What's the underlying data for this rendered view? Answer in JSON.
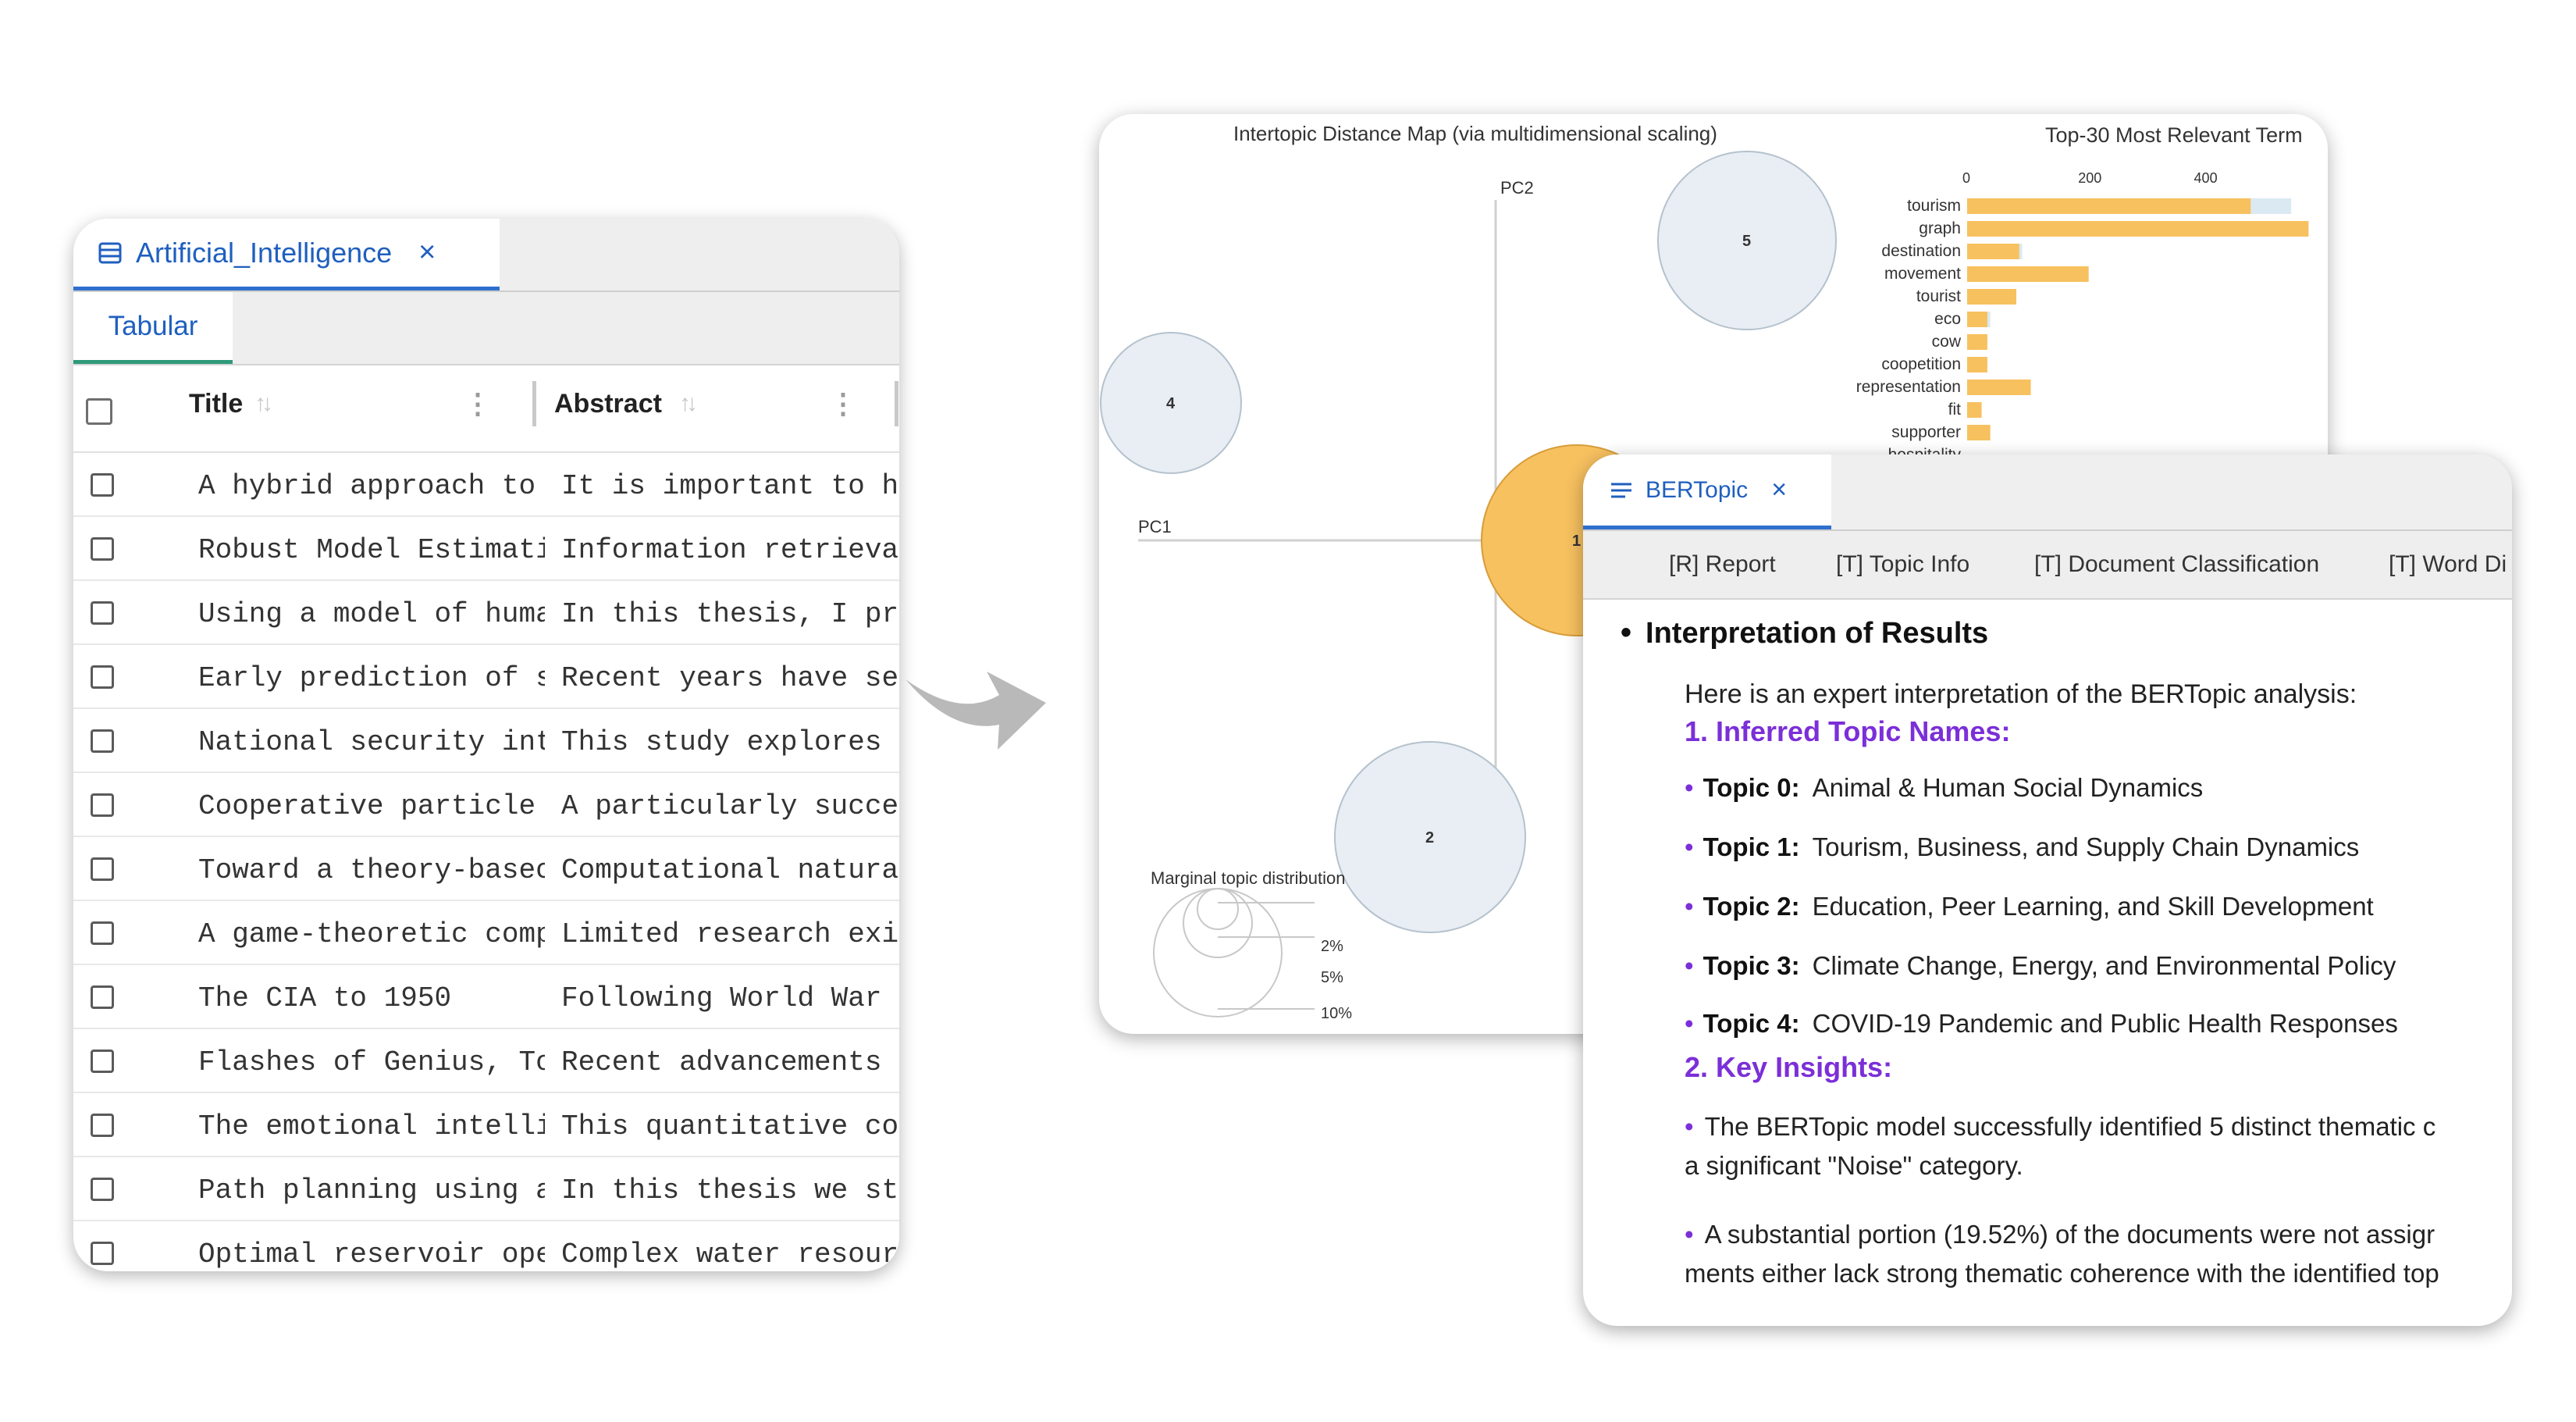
{
  "dataset_panel": {
    "tab_title": "Artificial_Intelligence",
    "tab_close": "×",
    "subtab": "Tabular",
    "columns": {
      "title": "Title",
      "abstract": "Abstract"
    },
    "sort_glyph": "↑↓",
    "menu_glyph": "⋮",
    "rows": [
      {
        "title": "A hybrid approach to",
        "abstract": "It is important to ha"
      },
      {
        "title": "Robust Model Estimati",
        "abstract": "Information retrieval"
      },
      {
        "title": "Using a model of huma",
        "abstract": "In this thesis, I pre"
      },
      {
        "title": "Early prediction of s",
        "abstract": "Recent years have see"
      },
      {
        "title": "National security int",
        "abstract": "This study explores m"
      },
      {
        "title": "Cooperative particle",
        "abstract": "A particularly succes"
      },
      {
        "title": "Toward a theory-basec",
        "abstract": "Computational natural"
      },
      {
        "title": "A game-theoretic comp",
        "abstract": "Limited research exis"
      },
      {
        "title": "The CIA to 1950",
        "abstract": "Following World War I"
      },
      {
        "title": "Flashes of Genius, To",
        "abstract": "Recent advancements i"
      },
      {
        "title": "The emotional intelli",
        "abstract": "This quantitative cor"
      },
      {
        "title": "Path planning using a",
        "abstract": "In this thesis we stu"
      },
      {
        "title": "Optimal reservoir ope",
        "abstract": "Complex water resourc"
      }
    ]
  },
  "visualization": {
    "distance_map_title": "Intertopic Distance Map (via multidimensional scaling)",
    "pc2_label": "PC2",
    "pc1_label": "PC1",
    "bubbles": [
      {
        "label": "5",
        "color": "#e8eef4"
      },
      {
        "label": "4",
        "color": "#e8eef4"
      },
      {
        "label": "2",
        "color": "#e8eef4"
      },
      {
        "label": "1",
        "color": "#f7c160"
      }
    ],
    "marginal_title": "Marginal topic distribution",
    "marginal_legend": [
      "2%",
      "5%",
      "10%"
    ],
    "terms_title": "Top-30 Most Relevant Term",
    "terms_axis_ticks": [
      "0",
      "200",
      "400"
    ],
    "terms": [
      "tourism",
      "graph",
      "destination",
      "movement",
      "tourist",
      "eco",
      "cow",
      "coopetition",
      "representation",
      "fit",
      "supporter",
      "hospitality"
    ],
    "bar_color": "#f7c160",
    "bar_bg_color": "#dbe9f2"
  },
  "chart_data": {
    "type": "bar",
    "title": "Top-30 Most Relevant Term",
    "categories": [
      "tourism",
      "graph",
      "destination",
      "movement",
      "tourist",
      "eco",
      "cow",
      "coopetition",
      "representation",
      "fit",
      "supporter"
    ],
    "series": [
      {
        "values": [
          490,
          590,
          90,
          210,
          85,
          35,
          35,
          35,
          110,
          25,
          40
        ]
      },
      {
        "values": [
          560,
          570,
          95,
          150,
          75,
          40,
          30,
          30,
          85,
          25,
          35
        ]
      }
    ],
    "xlim": [
      0,
      580
    ],
    "xticks": [
      0,
      200,
      400
    ]
  },
  "bertopic_panel": {
    "tab_title": "BERTopic",
    "tab_close": "×",
    "subtabs": [
      "[R] Report",
      "[T] Topic Info",
      "[T] Document Classification",
      "[T] Word Di"
    ],
    "heading": "Interpretation of Results",
    "intro": "Here is an expert interpretation of the BERTopic analysis:",
    "section1": "1. Inferred Topic Names:",
    "topics": [
      {
        "key": "Topic 0:",
        "name": "Animal & Human Social Dynamics"
      },
      {
        "key": "Topic 1:",
        "name": "Tourism, Business, and Supply Chain Dynamics"
      },
      {
        "key": "Topic 2:",
        "name": "Education, Peer Learning, and Skill Development"
      },
      {
        "key": "Topic 3:",
        "name": "Climate Change, Energy, and Environmental Policy"
      },
      {
        "key": "Topic 4:",
        "name": "COVID-19 Pandemic and Public Health Responses"
      }
    ],
    "section2": "2. Key Insights:",
    "insight1_line1": "The BERTopic model successfully identified 5 distinct thematic c",
    "insight1_line2": "a significant \"Noise\" category.",
    "insight2_line1": "A substantial portion (19.52%) of the documents were not assigr",
    "insight2_line2": "ments either lack strong thematic coherence with the identified top",
    "bullet": "•"
  }
}
